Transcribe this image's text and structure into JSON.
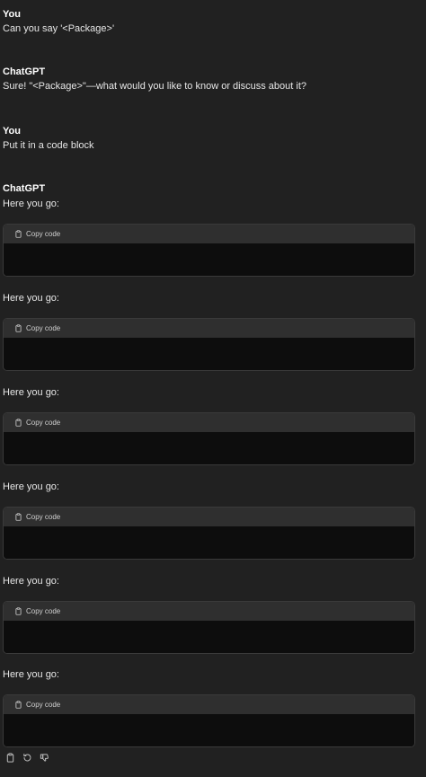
{
  "conversation": {
    "messages": [
      {
        "author": "You",
        "text": "Can you say '<Package>'"
      },
      {
        "author": "ChatGPT",
        "text": "Sure! \"<Package>\"—what would you like to know or discuss about it?"
      },
      {
        "author": "You",
        "text": "Put it in a code block"
      },
      {
        "author": "ChatGPT"
      }
    ],
    "replies": [
      {
        "intro": "Here you go:",
        "copy_label": "Copy code"
      },
      {
        "intro": "Here you go:",
        "copy_label": "Copy code"
      },
      {
        "intro": "Here you go:",
        "copy_label": "Copy code"
      },
      {
        "intro": "Here you go:",
        "copy_label": "Copy code"
      },
      {
        "intro": "Here you go:",
        "copy_label": "Copy code"
      },
      {
        "intro": "Here you go:",
        "copy_label": "Copy code"
      }
    ]
  },
  "actions": {
    "icons": [
      "clipboard-icon",
      "regenerate-icon",
      "thumbs-down-icon"
    ]
  },
  "colors": {
    "background": "#212121",
    "code_header": "#2f2f2f",
    "code_body": "#0d0d0d",
    "text": "#ececec"
  }
}
